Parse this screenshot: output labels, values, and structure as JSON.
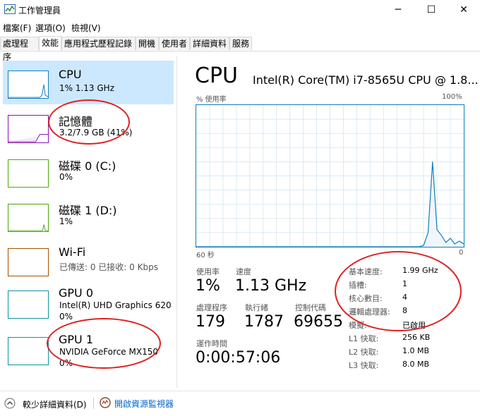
{
  "window": {
    "title": "工作管理員",
    "minimize_glyph": "─",
    "maximize_glyph": "☐",
    "close_glyph": "✕"
  },
  "menu": [
    "檔案(F)",
    "選項(O)",
    "檢視(V)"
  ],
  "tabs": [
    "處理程序",
    "效能",
    "應用程式歷程記錄",
    "開機",
    "使用者",
    "詳細資料",
    "服務"
  ],
  "sidebar": {
    "items": [
      {
        "title": "CPU",
        "line1": "1% 1.13 GHz",
        "line2": "",
        "color": "#117dbb"
      },
      {
        "title": "記憶體",
        "line1": "3.2/7.9 GB (41%)",
        "line2": "",
        "color": "#8b12ae"
      },
      {
        "title": "磁碟 0 (C:)",
        "line1": "0%",
        "line2": "",
        "color": "#4da60c"
      },
      {
        "title": "磁碟 1 (D:)",
        "line1": "1%",
        "line2": "",
        "color": "#4da60c"
      },
      {
        "title": "Wi-Fi",
        "line1": "已傳送: 0 已接收: 0 Kbps",
        "line2": "",
        "color": "#a74f01"
      },
      {
        "title": "GPU 0",
        "line1": "Intel(R) UHD Graphics 620",
        "line2": "0%",
        "color": "#0d94a6"
      },
      {
        "title": "GPU 1",
        "line1": "NVIDIA GeForce MX150",
        "line2": "0%",
        "color": "#0d94a6"
      }
    ]
  },
  "main": {
    "title": "CPU",
    "model": "Intel(R) Core(TM) i7-8565U CPU @ 1.8...",
    "graph": {
      "y_label": "% 使用率",
      "y_max_label": "100%",
      "x_left_label": "60 秒",
      "x_right_label": "0",
      "usage_series": [
        0,
        0,
        0,
        0,
        0,
        0,
        0,
        0,
        0,
        0,
        0,
        0,
        0,
        0,
        0,
        0,
        0,
        0,
        0,
        0,
        0,
        0,
        0,
        0,
        0,
        0,
        0,
        0,
        0,
        0,
        0,
        0,
        0,
        0,
        0,
        0,
        0,
        0,
        0,
        0,
        0,
        0,
        0,
        0,
        0,
        0,
        0,
        0,
        0,
        0,
        0,
        1,
        10,
        60,
        12,
        8,
        3,
        6,
        2,
        4,
        2
      ],
      "line_color": "#117dbb",
      "fill_color": "#f1f6fa",
      "grid_color": "#d9eaf4"
    },
    "stats": {
      "usage_label": "使用率",
      "usage_value": "1%",
      "speed_label": "速度",
      "speed_value": "1.13 GHz",
      "processes_label": "處理程序",
      "processes_value": "179",
      "threads_label": "執行緒",
      "threads_value": "1787",
      "handles_label": "控制代碼",
      "handles_value": "69655",
      "uptime_label": "運作時間",
      "uptime_value": "0:00:57:06"
    },
    "details": [
      {
        "label": "基本速度:",
        "value": "1.99 GHz"
      },
      {
        "label": "插槽:",
        "value": "1"
      },
      {
        "label": "核心數目:",
        "value": "4"
      },
      {
        "label": "邏輯處理器:",
        "value": "8"
      },
      {
        "label": "模擬:",
        "value": "已啟用"
      },
      {
        "label": "L1 快取:",
        "value": "256 KB"
      },
      {
        "label": "L2 快取:",
        "value": "1.0 MB"
      },
      {
        "label": "L3 快取:",
        "value": "8.0 MB"
      }
    ]
  },
  "footer": {
    "fewer_details": "較少詳細資料(D)",
    "open_monitor": "開啟資源監視器"
  },
  "annotation_color": "#e02020"
}
